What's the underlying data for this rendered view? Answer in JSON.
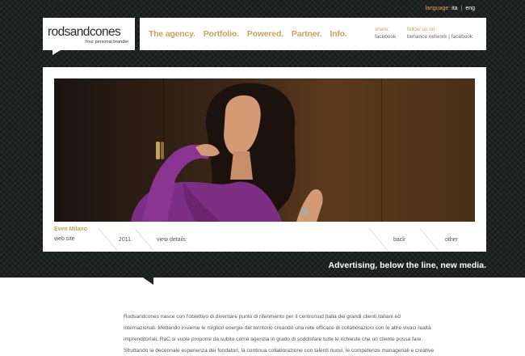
{
  "language": {
    "label": "language:",
    "options": [
      "ita",
      "eng"
    ],
    "separator": "|"
  },
  "logo": {
    "name": "rodsandcones",
    "tagline": "Your personal brander"
  },
  "nav": {
    "items": [
      "The agency.",
      "Portfolio.",
      "Powered.",
      "Partner.",
      "Info."
    ]
  },
  "share": {
    "label": "share:",
    "link": "facebook"
  },
  "follow": {
    "label": "follow us on:",
    "link": "behance network | facebook"
  },
  "project": {
    "title": "Even Milano",
    "subtitle": "web site",
    "year": "2011",
    "details": "view details",
    "back": "back",
    "other": "other"
  },
  "tagline": "Advertising, below the line, new media.",
  "about": {
    "lines": [
      "Rodsandcones nasce con l'obiettivo di diventare punto di riferimento per il centro/sud Italia dei grandi clienti italiani ed",
      "internazionali. Mettendo insieme le migliori energie del territorio creando una rete efficace di collaborazioni con le altre vivaci realtà",
      "imprenditoriali, RaC si vuole proporre da subito come agenzia in grado di soddisfare tutte le richieste che un cliente possa fare.",
      "Sfruttando la decennale esperienza dei fondatori, la continua collaborazione con talenti nuovi, le competenze manageriali e creative"
    ]
  },
  "colors": {
    "accent": "#c9a35a",
    "background_dark": "#1e2321"
  }
}
